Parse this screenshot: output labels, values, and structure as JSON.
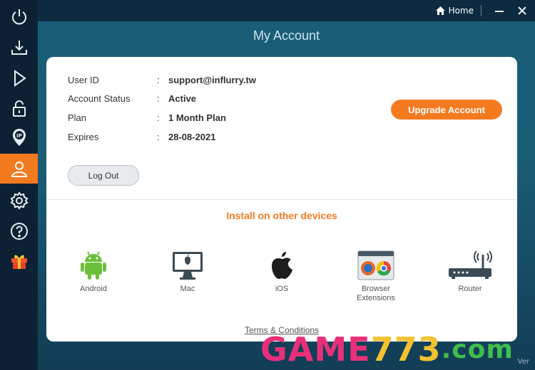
{
  "topbar": {
    "home_label": "Home"
  },
  "sidebar": {
    "items": [
      {
        "icon": "power-icon"
      },
      {
        "icon": "download-icon"
      },
      {
        "icon": "play-icon"
      },
      {
        "icon": "unlock-icon"
      },
      {
        "icon": "ip-location-icon"
      },
      {
        "icon": "user-icon",
        "active": true
      },
      {
        "icon": "gear-icon"
      },
      {
        "icon": "help-icon"
      },
      {
        "icon": "gift-icon"
      }
    ]
  },
  "page": {
    "title": "My Account"
  },
  "account": {
    "fields": [
      {
        "label": "User ID",
        "value": "support@influrry.tw"
      },
      {
        "label": "Account Status",
        "value": "Active"
      },
      {
        "label": "Plan",
        "value": "1 Month Plan"
      },
      {
        "label": "Expires",
        "value": "28-08-2021"
      }
    ],
    "separator": ":",
    "upgrade_label": "Upgrade Account",
    "logout_label": "Log Out"
  },
  "install": {
    "title": "Install on other devices",
    "devices": [
      {
        "label": "Android",
        "icon": "android-icon"
      },
      {
        "label": "Mac",
        "icon": "mac-monitor-icon"
      },
      {
        "label": "iOS",
        "icon": "apple-icon"
      },
      {
        "label": "Browser Extensions",
        "icon": "browser-extensions-icon"
      },
      {
        "label": "Router",
        "icon": "router-icon"
      }
    ]
  },
  "footer": {
    "terms_label": "Terms & Conditions",
    "version_label": "Ver"
  },
  "watermark": {
    "part_a": "GAME",
    "part_b": "773",
    "part_c": ".com"
  },
  "colors": {
    "accent": "#f47a20",
    "sidebar": "#0c2234",
    "card": "#ffffff"
  }
}
